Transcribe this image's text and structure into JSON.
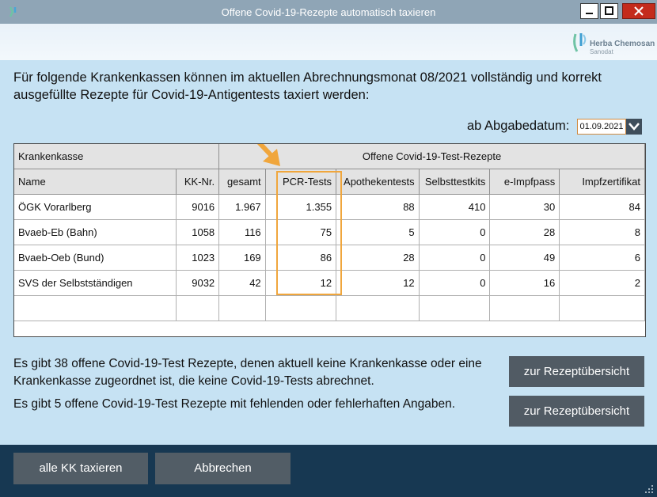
{
  "window": {
    "title": "Offene Covid-19-Rezepte automatisch taxieren"
  },
  "logo": {
    "name": "Herba Chemosan",
    "sub": "Sanodat"
  },
  "intro": "Für folgende Krankenkassen können im aktuellen Abrechnungsmonat 08/2021 vollständig und korrekt ausgefüllte Rezepte für Covid-19-Antigentests taxiert werden:",
  "date": {
    "label": "ab Abgabedatum:",
    "value": "01.09.2021"
  },
  "grid": {
    "group_header_left": "Krankenkasse",
    "group_header_right": "Offene Covid-19-Test-Rezepte",
    "columns": [
      "Name",
      "KK-Nr.",
      "gesamt",
      "PCR-Tests",
      "Apothekentests",
      "Selbsttestkits",
      "e-Impfpass",
      "Impfzertifikat"
    ],
    "rows": [
      {
        "name": "ÖGK Vorarlberg",
        "kk": "9016",
        "gesamt": "1.967",
        "pcr": "1.355",
        "apo": "88",
        "selbst": "410",
        "eimpf": "30",
        "zert": "84"
      },
      {
        "name": "Bvaeb-Eb (Bahn)",
        "kk": "1058",
        "gesamt": "116",
        "pcr": "75",
        "apo": "5",
        "selbst": "0",
        "eimpf": "28",
        "zert": "8"
      },
      {
        "name": "Bvaeb-Oeb (Bund)",
        "kk": "1023",
        "gesamt": "169",
        "pcr": "86",
        "apo": "28",
        "selbst": "0",
        "eimpf": "49",
        "zert": "6"
      },
      {
        "name": "SVS der Selbstständigen",
        "kk": "9032",
        "gesamt": "42",
        "pcr": "12",
        "apo": "12",
        "selbst": "0",
        "eimpf": "16",
        "zert": "2"
      }
    ]
  },
  "info": {
    "unassigned_text": "Es gibt 38 offene Covid-19-Test Rezepte, denen aktuell keine Krankenkasse oder eine Krankenkasse zugeordnet ist, die keine Covid-19-Tests abrechnet.",
    "faulty_text": "Es gibt 5 offene Covid-19-Test Rezepte mit fehlenden oder fehlerhaften Angaben.",
    "overview_button": "zur Rezeptübersicht",
    "overview_button_2": "zur Rezeptübersicht"
  },
  "footer": {
    "all_button": "alle KK taxieren",
    "cancel_button": "Abbrechen"
  },
  "colors": {
    "titlebar": "#8fa5b6",
    "content_bg": "#c6e2f3",
    "footer_bg": "#173852",
    "button_bg": "#525d66",
    "highlight": "#f0a63c",
    "close_button": "#c42b1c"
  },
  "icons": [
    "app-icon",
    "minimize-icon",
    "maximize-icon",
    "close-icon",
    "chevron-down-icon",
    "resize-grip-icon",
    "arrow-annotation-icon"
  ]
}
